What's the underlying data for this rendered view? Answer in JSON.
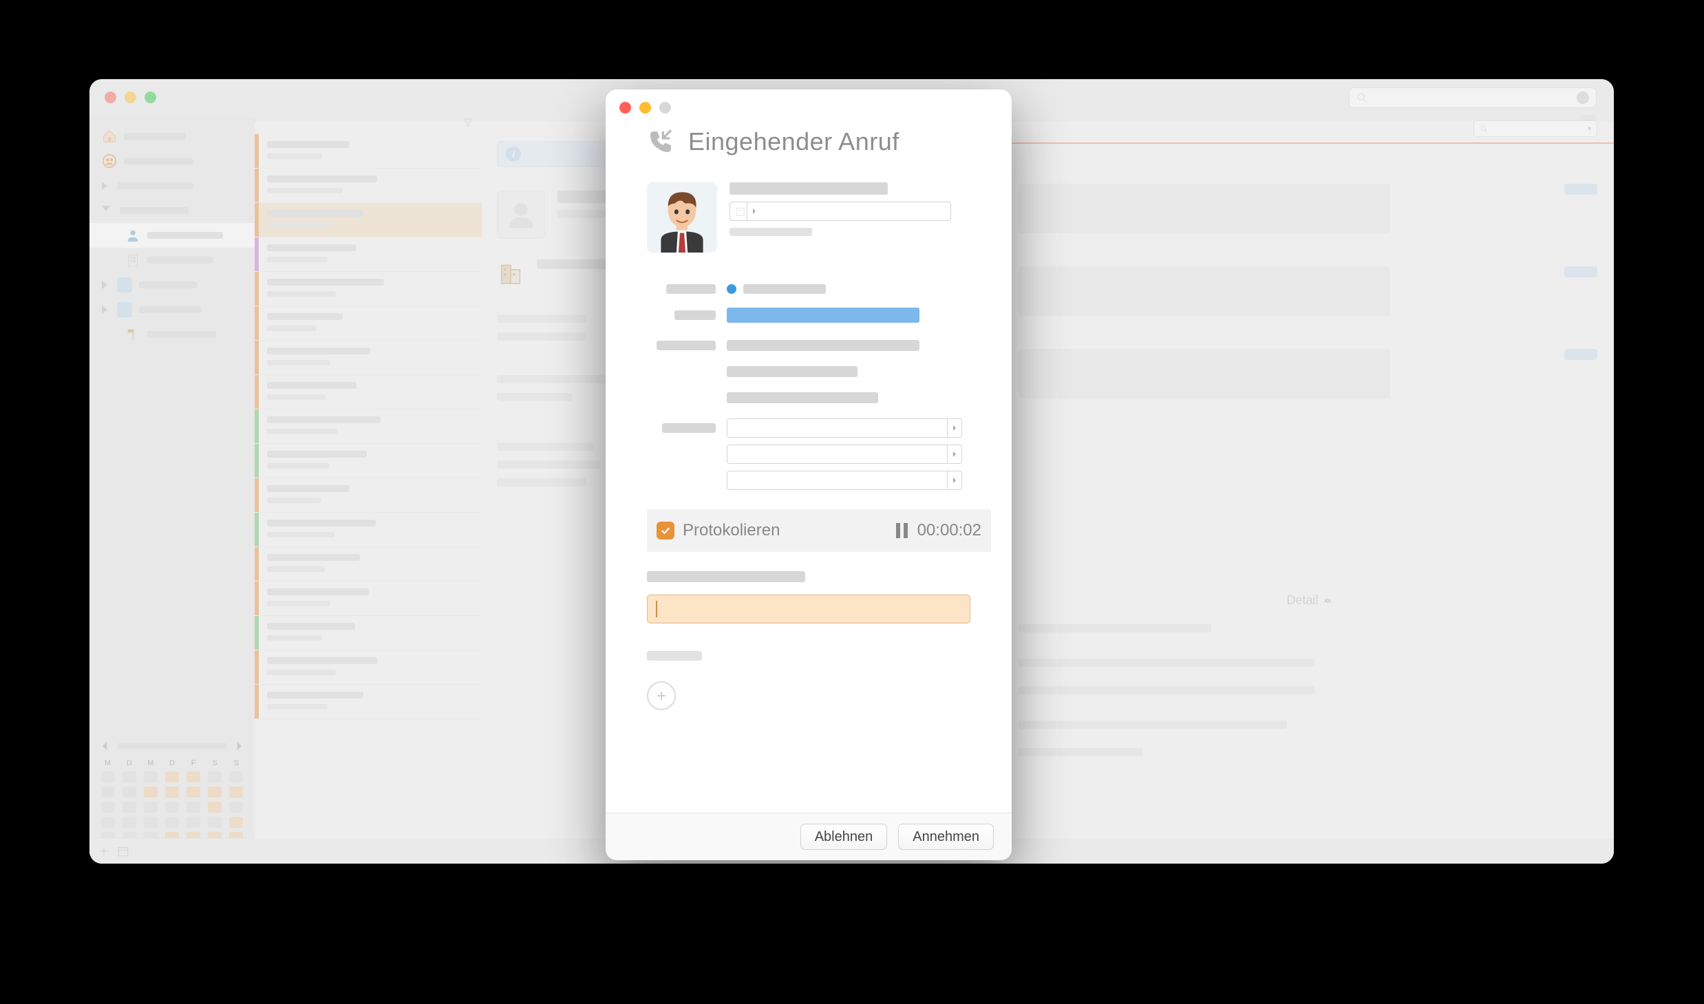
{
  "main_window": {
    "search": {
      "placeholder": ""
    },
    "sidebar": {
      "calendar": {
        "dow": [
          "M",
          "D",
          "M",
          "D",
          "F",
          "S",
          "S"
        ]
      }
    },
    "right_panel": {
      "detail_label": "Detail"
    }
  },
  "modal": {
    "title": "Eingehender Anruf",
    "protocol": {
      "label": "Protokolieren",
      "checked": true
    },
    "timer": "00:00:02",
    "note": {
      "value": ""
    },
    "actions": {
      "decline": "Ablehnen",
      "accept": "Annehmen"
    }
  },
  "list_rows": [
    {
      "stripe": "#e8923a",
      "w1": 120,
      "w2": 80
    },
    {
      "stripe": "#e8923a",
      "w1": 160,
      "w2": 110
    },
    {
      "stripe": "#e8923a",
      "w1": 140,
      "w2": 95,
      "sel": true
    },
    {
      "stripe": "#c07cc4",
      "w1": 130,
      "w2": 88
    },
    {
      "stripe": "#e8923a",
      "w1": 170,
      "w2": 100
    },
    {
      "stripe": "#e8923a",
      "w1": 110,
      "w2": 72
    },
    {
      "stripe": "#e8923a",
      "w1": 150,
      "w2": 92
    },
    {
      "stripe": "#e8923a",
      "w1": 130,
      "w2": 85
    },
    {
      "stripe": "#6fc06f",
      "w1": 165,
      "w2": 102
    },
    {
      "stripe": "#6fc06f",
      "w1": 145,
      "w2": 90
    },
    {
      "stripe": "#e8923a",
      "w1": 120,
      "w2": 78
    },
    {
      "stripe": "#6fc06f",
      "w1": 158,
      "w2": 98
    },
    {
      "stripe": "#e8923a",
      "w1": 135,
      "w2": 84
    },
    {
      "stripe": "#e8923a",
      "w1": 148,
      "w2": 92
    },
    {
      "stripe": "#6fc06f",
      "w1": 128,
      "w2": 80
    },
    {
      "stripe": "#e8923a",
      "w1": 160,
      "w2": 100
    },
    {
      "stripe": "#e8923a",
      "w1": 140,
      "w2": 88
    }
  ]
}
